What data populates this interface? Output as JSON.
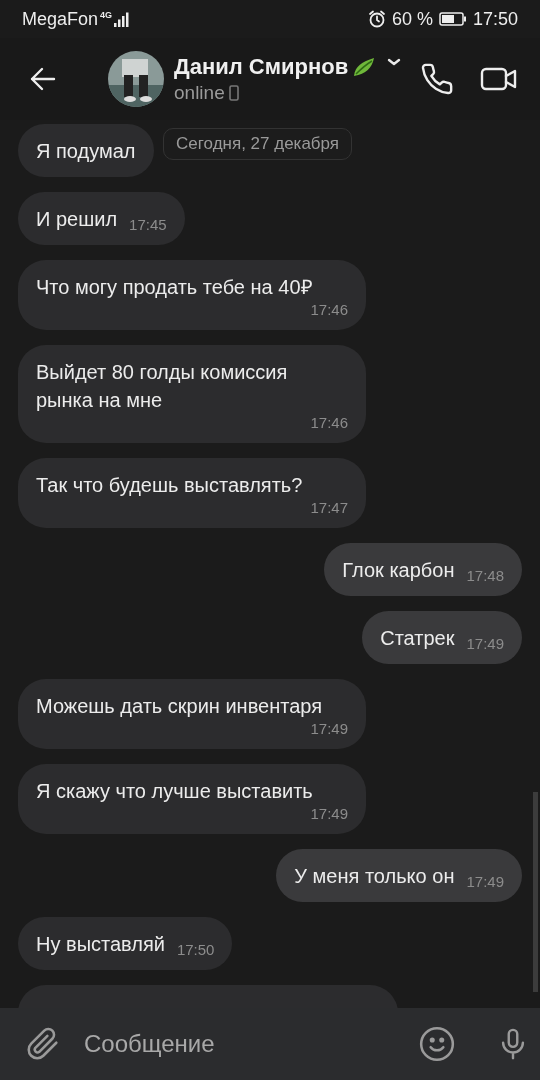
{
  "status_bar": {
    "carrier": "MegaFon",
    "network": "4G",
    "battery": "60 %",
    "time": "17:50"
  },
  "header": {
    "name": "Данил Смирнов",
    "status": "online"
  },
  "date_label": "Сегодня, 27 декабря",
  "messages": [
    {
      "kind": "text",
      "outgoing": false,
      "text": "Я подумал"
    },
    {
      "kind": "text",
      "outgoing": false,
      "text": "И решил",
      "time": "17:45"
    },
    {
      "kind": "text",
      "outgoing": false,
      "text": "Что могу продать тебе на 40₽",
      "time": "17:46"
    },
    {
      "kind": "text",
      "outgoing": false,
      "text": "Выйдет 80 голды комиссия рынка на мне",
      "time": "17:46"
    },
    {
      "kind": "text",
      "outgoing": false,
      "text": "Так что будешь выставлять?",
      "time": "17:47"
    },
    {
      "kind": "text",
      "outgoing": true,
      "text": "Глок карбон",
      "time": "17:48"
    },
    {
      "kind": "text",
      "outgoing": true,
      "text": "Статрек",
      "time": "17:49"
    },
    {
      "kind": "text",
      "outgoing": false,
      "text": "Можешь дать скрин инвентаря",
      "time": "17:49"
    },
    {
      "kind": "text",
      "outgoing": false,
      "text": "Я скажу что лучше выставить",
      "time": "17:49"
    },
    {
      "kind": "text",
      "outgoing": true,
      "text": "У меня только он",
      "time": "17:49"
    },
    {
      "kind": "text",
      "outgoing": false,
      "text": "Ну выставляй",
      "time": "17:50"
    },
    {
      "kind": "cut",
      "outgoing": false
    }
  ],
  "composer": {
    "placeholder": "Сообщение"
  }
}
